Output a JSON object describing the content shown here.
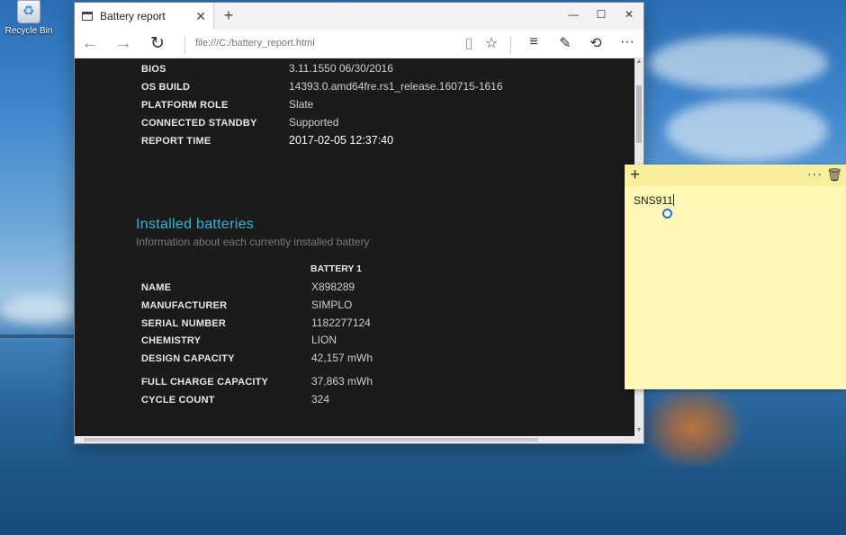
{
  "desktop": {
    "recycle_bin_label": "Recycle Bin"
  },
  "browser": {
    "tab_title": "Battery report",
    "url": "file:///C:/battery_report.html",
    "controls": {
      "minimize": "—",
      "maximize": "☐",
      "close": "✕",
      "tab_close": "✕",
      "new_tab": "+"
    }
  },
  "report": {
    "system_rows": [
      {
        "label": "BIOS",
        "value": "3.11.1550 06/30/2016"
      },
      {
        "label": "OS BUILD",
        "value": "14393.0.amd64fre.rs1_release.160715-1616"
      },
      {
        "label": "PLATFORM ROLE",
        "value": "Slate"
      },
      {
        "label": "CONNECTED STANDBY",
        "value": "Supported"
      },
      {
        "label": "REPORT TIME",
        "value": "2017-02-05  12:37:40"
      }
    ],
    "section_title": "Installed batteries",
    "section_subtitle": "Information about each currently installed battery",
    "column_header": "BATTERY 1",
    "battery_rows": [
      {
        "label": "NAME",
        "value": "X898289"
      },
      {
        "label": "MANUFACTURER",
        "value": "SIMPLO"
      },
      {
        "label": "SERIAL NUMBER",
        "value": "1182277124"
      },
      {
        "label": "CHEMISTRY",
        "value": "LION"
      },
      {
        "label": "DESIGN CAPACITY",
        "value": "42,157 mWh"
      },
      {
        "label": "FULL CHARGE CAPACITY",
        "value": "37,863 mWh"
      },
      {
        "label": "CYCLE COUNT",
        "value": "324"
      }
    ]
  },
  "sticky_note": {
    "text": "SNS911",
    "more": "···"
  },
  "colors": {
    "accent": "#28b9d8",
    "content_bg": "#1b1b1b",
    "sticky_bg": "#fdf7b3"
  }
}
